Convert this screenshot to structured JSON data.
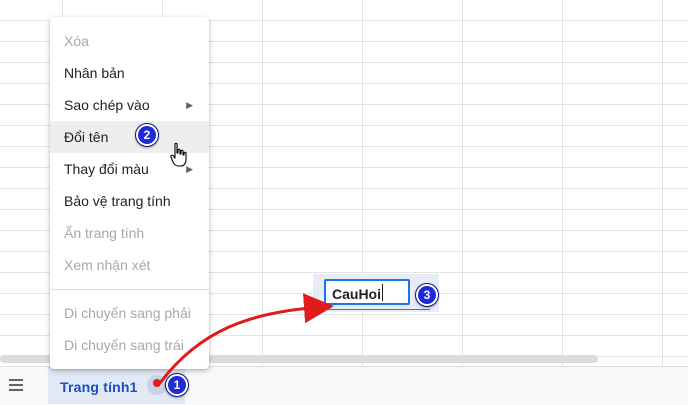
{
  "context_menu": {
    "items": [
      {
        "label": "Xóa",
        "enabled": false,
        "submenu": false
      },
      {
        "label": "Nhân bản",
        "enabled": true,
        "submenu": false
      },
      {
        "label": "Sao chép vào",
        "enabled": true,
        "submenu": true
      },
      {
        "label": "Đổi tên",
        "enabled": true,
        "submenu": false,
        "highlighted": true
      },
      {
        "label": "Thay đổi màu",
        "enabled": true,
        "submenu": true
      },
      {
        "label": "Bảo vệ trang tính",
        "enabled": true,
        "submenu": false
      },
      {
        "label": "Ẩn trang tính",
        "enabled": false,
        "submenu": false
      },
      {
        "label": "Xem nhận xét",
        "enabled": false,
        "submenu": false
      },
      {
        "label": "Di chuyển sang phải",
        "enabled": false,
        "submenu": false
      },
      {
        "label": "Di chuyển sang trái",
        "enabled": false,
        "submenu": false
      }
    ]
  },
  "sheet_tab": {
    "label": "Trang tính1"
  },
  "rename": {
    "value": "CauHoi"
  },
  "annotations": {
    "step1": "1",
    "step2": "2",
    "step3": "3"
  },
  "colors": {
    "accent": "#1a73e8",
    "badge": "#1f2bd6",
    "arrow": "#e01b1b"
  },
  "icons": {
    "menu": "hamburger-icon",
    "pointer": "hand-pointer-icon",
    "submenu": "triangle-right-icon"
  }
}
